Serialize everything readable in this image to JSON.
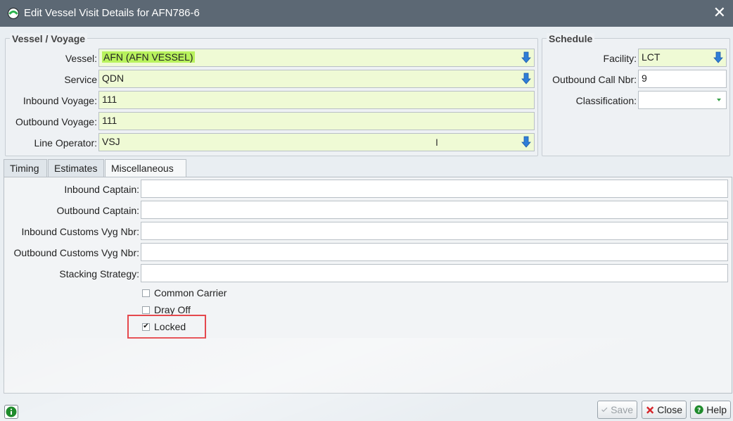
{
  "window": {
    "title": "Edit Vessel Visit Details for AFN786-6"
  },
  "vessel_voyage": {
    "legend": "Vessel / Voyage",
    "vessel_label": "Vessel:",
    "vessel_value": "AFN (AFN VESSEL)",
    "service_label": "Service",
    "service_value": "QDN",
    "inbound_voyage_label": "Inbound Voyage:",
    "inbound_voyage_value": "111",
    "outbound_voyage_label": "Outbound Voyage:",
    "outbound_voyage_value": "111",
    "line_operator_label": "Line Operator:",
    "line_operator_value": "VSJ"
  },
  "schedule": {
    "legend": "Schedule",
    "facility_label": "Facility:",
    "facility_value": "LCT",
    "outbound_call_label": "Outbound Call Nbr:",
    "outbound_call_value": "9",
    "classification_label": "Classification:",
    "classification_value": ""
  },
  "tabs": [
    {
      "label": "Timing"
    },
    {
      "label": "Estimates"
    },
    {
      "label": "Miscellaneous"
    }
  ],
  "misc": {
    "inbound_captain_label": "Inbound Captain:",
    "inbound_captain_value": "",
    "outbound_captain_label": "Outbound Captain:",
    "outbound_captain_value": "",
    "inbound_customs_label": "Inbound Customs Vyg Nbr:",
    "inbound_customs_value": "",
    "outbound_customs_label": "Outbound Customs Vyg Nbr:",
    "outbound_customs_value": "",
    "stacking_label": "Stacking Strategy:",
    "stacking_value": "",
    "common_carrier_label": "Common Carrier",
    "common_carrier_checked": false,
    "dray_off_label": "Dray Off",
    "dray_off_checked": false,
    "locked_label": "Locked",
    "locked_checked": true,
    "checkmark": "✔"
  },
  "buttons": {
    "save": "Save",
    "close": "Close",
    "help": "Help"
  },
  "colors": {
    "titlebar": "#5c6874",
    "required_field": "#effad5",
    "highlight": "#b8f25d",
    "callout_border": "#e5484d"
  }
}
